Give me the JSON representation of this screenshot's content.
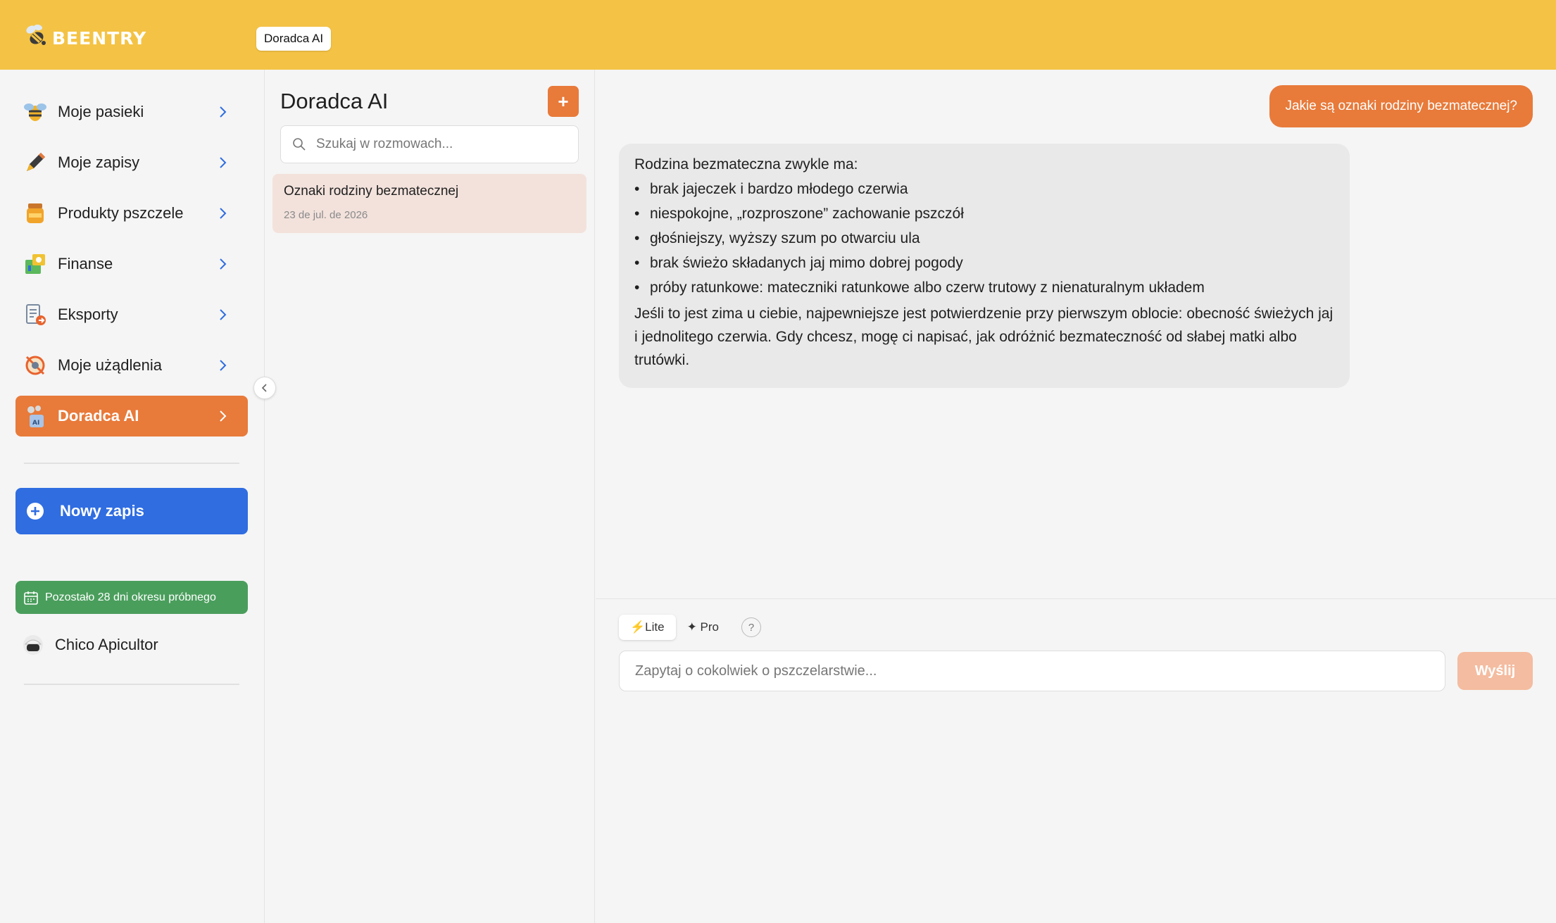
{
  "header": {
    "logo_text": "BEENTRY",
    "tab_label": "Doradca AI"
  },
  "sidebar": {
    "items": [
      {
        "label": "Moje pasieki",
        "icon": "bee-icon"
      },
      {
        "label": "Moje zapisy",
        "icon": "pencil-icon"
      },
      {
        "label": "Produkty pszczele",
        "icon": "honey-jar-icon"
      },
      {
        "label": "Finanse",
        "icon": "finance-icon"
      },
      {
        "label": "Eksporty",
        "icon": "export-icon"
      },
      {
        "label": "Moje użądlenia",
        "icon": "sting-icon"
      },
      {
        "label": "Doradca AI",
        "icon": "ai-advisor-icon",
        "active": true
      }
    ],
    "new_entry_label": "Nowy zapis",
    "trial_text": "Pozostało 28 dni okresu próbnego",
    "user_name": "Chico Apicultor"
  },
  "conversations": {
    "title": "Doradca AI",
    "add_label": "+",
    "search_placeholder": "Szukaj w rozmowach...",
    "items": [
      {
        "title": "Oznaki rodziny bezmatecznej",
        "date": "23 de jul. de 2026"
      }
    ]
  },
  "chat": {
    "user_message": "Jakie są oznaki rodziny bezmatecznej?",
    "ai_intro": "Rodzina bezmateczna zwykle ma:",
    "ai_bullets": [
      "brak jajeczek i bardzo młodego czerwia",
      "niespokojne, „rozproszone” zachowanie pszczół",
      "głośniejszy, wyższy szum po otwarciu ula",
      "brak świeżo składanych jaj mimo dobrej pogody",
      "próby ratunkowe: mateczniki ratunkowe albo czerw trutowy z nienaturalnym układem"
    ],
    "ai_outro": "Jeśli to jest zima u ciebie, najpewniejsze jest potwierdzenie przy pierwszym oblocie: obecność świeżych jaj i jednolitego czerwia. Gdy chcesz, mogę ci napisać, jak odróżnić bezmateczność od słabej matki albo trutówki."
  },
  "composer": {
    "mode_lite": "⚡Lite",
    "mode_pro": "✦ Pro",
    "help_label": "?",
    "input_placeholder": "Zapytaj o cokolwiek o pszczelarstwie...",
    "send_label": "Wyślij"
  },
  "colors": {
    "header": "#f4c345",
    "accent_orange": "#e87a3a",
    "primary_blue": "#2f6de1",
    "trial_green": "#4a9e5c"
  }
}
